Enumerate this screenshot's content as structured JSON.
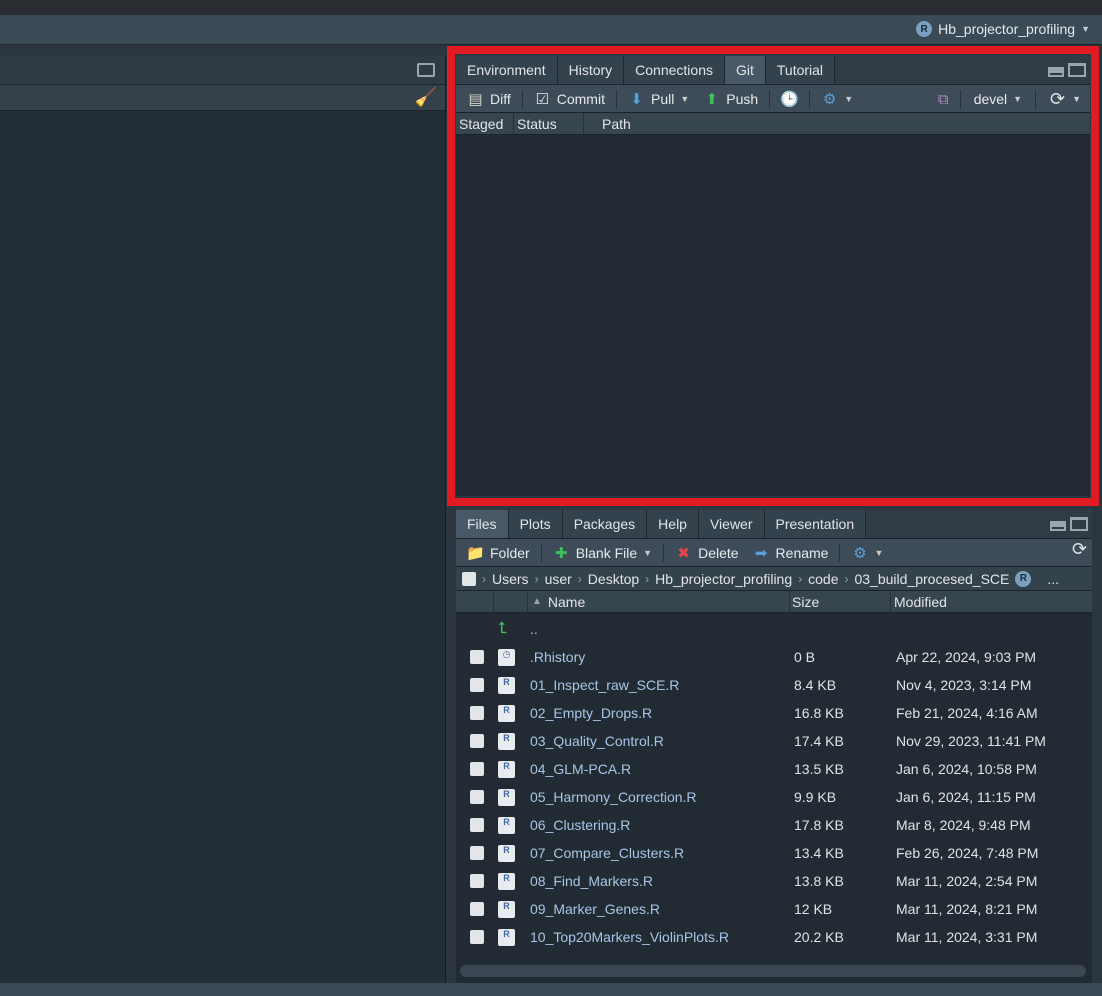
{
  "project": {
    "name": "Hb_projector_profiling"
  },
  "git_pane": {
    "tabs": [
      {
        "label": "Environment",
        "active": false
      },
      {
        "label": "History",
        "active": false
      },
      {
        "label": "Connections",
        "active": false
      },
      {
        "label": "Git",
        "active": true
      },
      {
        "label": "Tutorial",
        "active": false
      }
    ],
    "toolbar": {
      "diff": "Diff",
      "commit": "Commit",
      "pull": "Pull",
      "push": "Push",
      "branch": "devel"
    },
    "columns": {
      "staged": "Staged",
      "status": "Status",
      "path": "Path"
    }
  },
  "files_pane": {
    "tabs": [
      {
        "label": "Files",
        "active": true
      },
      {
        "label": "Plots",
        "active": false
      },
      {
        "label": "Packages",
        "active": false
      },
      {
        "label": "Help",
        "active": false
      },
      {
        "label": "Viewer",
        "active": false
      },
      {
        "label": "Presentation",
        "active": false
      }
    ],
    "toolbar": {
      "folder": "Folder",
      "blank_file": "Blank File",
      "delete": "Delete",
      "rename": "Rename"
    },
    "breadcrumb": [
      "Users",
      "user",
      "Desktop",
      "Hb_projector_profiling",
      "code",
      "03_build_procesed_SCE"
    ],
    "breadcrumb_more": "...",
    "columns": {
      "name": "Name",
      "size": "Size",
      "modified": "Modified"
    },
    "parent_dir": "..",
    "files": [
      {
        "name": ".Rhistory",
        "size": "0 B",
        "modified": "Apr 22, 2024, 9:03 PM",
        "type": "history"
      },
      {
        "name": "01_Inspect_raw_SCE.R",
        "size": "8.4 KB",
        "modified": "Nov 4, 2023, 3:14 PM",
        "type": "r"
      },
      {
        "name": "02_Empty_Drops.R",
        "size": "16.8 KB",
        "modified": "Feb 21, 2024, 4:16 AM",
        "type": "r"
      },
      {
        "name": "03_Quality_Control.R",
        "size": "17.4 KB",
        "modified": "Nov 29, 2023, 11:41 PM",
        "type": "r"
      },
      {
        "name": "04_GLM-PCA.R",
        "size": "13.5 KB",
        "modified": "Jan 6, 2024, 10:58 PM",
        "type": "r"
      },
      {
        "name": "05_Harmony_Correction.R",
        "size": "9.9 KB",
        "modified": "Jan 6, 2024, 11:15 PM",
        "type": "r"
      },
      {
        "name": "06_Clustering.R",
        "size": "17.8 KB",
        "modified": "Mar 8, 2024, 9:48 PM",
        "type": "r"
      },
      {
        "name": "07_Compare_Clusters.R",
        "size": "13.4 KB",
        "modified": "Feb 26, 2024, 7:48 PM",
        "type": "r"
      },
      {
        "name": "08_Find_Markers.R",
        "size": "13.8 KB",
        "modified": "Mar 11, 2024, 2:54 PM",
        "type": "r"
      },
      {
        "name": "09_Marker_Genes.R",
        "size": "12 KB",
        "modified": "Mar 11, 2024, 8:21 PM",
        "type": "r"
      },
      {
        "name": "10_Top20Markers_ViolinPlots.R",
        "size": "20.2 KB",
        "modified": "Mar 11, 2024, 3:31 PM",
        "type": "r"
      }
    ]
  }
}
